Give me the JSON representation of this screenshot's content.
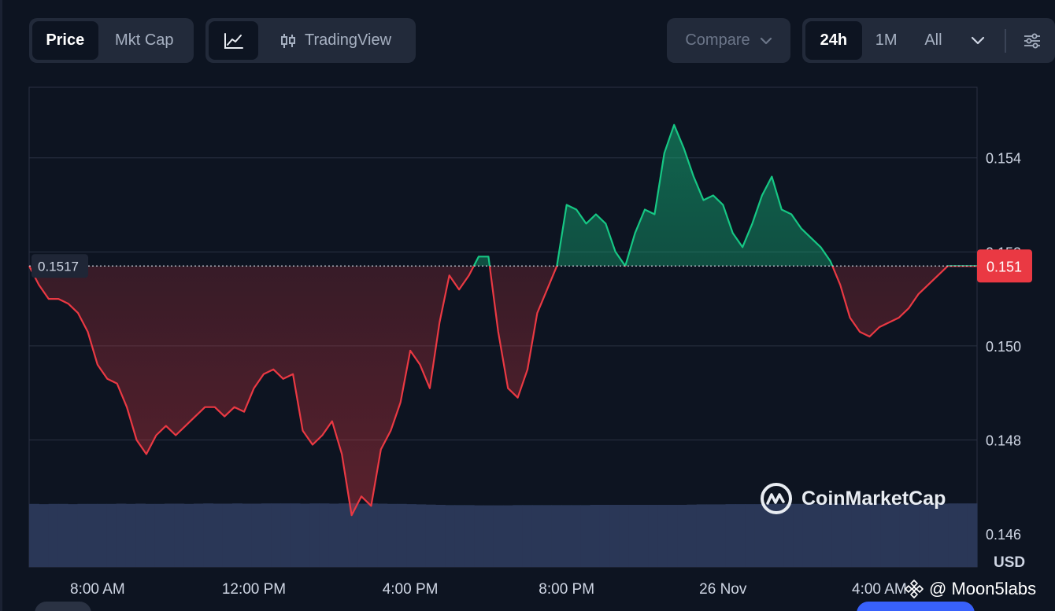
{
  "toolbar": {
    "type_tabs": [
      {
        "label": "Price",
        "active": true
      },
      {
        "label": "Mkt Cap",
        "active": false
      }
    ],
    "view_tabs": [
      {
        "icon": "line-chart-icon",
        "active": true
      },
      {
        "label": "TradingView",
        "icon": "candlestick-icon",
        "active": false
      }
    ],
    "compare_label": "Compare",
    "range_tabs": [
      {
        "label": "24h",
        "active": true
      },
      {
        "label": "1M",
        "active": false
      },
      {
        "label": "All",
        "active": false
      }
    ]
  },
  "watermark": "CoinMarketCap",
  "credit": "@ Moon5labs",
  "colors": {
    "up": "#16c784",
    "down": "#ea3943",
    "volume": "#2a3757",
    "background": "#0d1421",
    "badge": "#ea3943"
  },
  "chart_data": {
    "type": "area",
    "reference_label": "0.1517",
    "reference_value": 0.1517,
    "current_price_label": "0.151",
    "y_tick_labels": [
      "0.154",
      "0.152",
      "0.150",
      "0.148",
      "0.146"
    ],
    "y_ticks": [
      0.154,
      0.152,
      0.15,
      0.148,
      0.146
    ],
    "ylim": [
      0.1453,
      0.1555
    ],
    "y_unit_label": "USD",
    "x_tick_labels": [
      "8:00 AM",
      "12:00 PM",
      "4:00 PM",
      "8:00 PM",
      "26 Nov",
      "4:00 AM"
    ],
    "x_ticks": [
      8,
      12,
      16,
      20,
      24,
      28
    ],
    "xlim": [
      6.25,
      30.5
    ],
    "series": [
      {
        "x": [
          6.25,
          6.5,
          6.75,
          7.0,
          7.25,
          7.5,
          7.75,
          8.0,
          8.25,
          8.5,
          8.75,
          9.0,
          9.25,
          9.5,
          9.75,
          10.0,
          10.25,
          10.5,
          10.75,
          11.0,
          11.25,
          11.5,
          11.75,
          12.0,
          12.25,
          12.5,
          12.75,
          13.0,
          13.25,
          13.5,
          13.75,
          14.0,
          14.25,
          14.5,
          14.75,
          15.0,
          15.25,
          15.5,
          15.75,
          16.0,
          16.25,
          16.5,
          16.75,
          17.0,
          17.25,
          17.5,
          17.75,
          18.0,
          18.25,
          18.5,
          18.75,
          19.0,
          19.25,
          19.5,
          19.75,
          20.0,
          20.25,
          20.5,
          20.75,
          21.0,
          21.25,
          21.5,
          21.75,
          22.0,
          22.25,
          22.5,
          22.75,
          23.0,
          23.25,
          23.5,
          23.75,
          24.0,
          24.25,
          24.5,
          24.75,
          25.0,
          25.25,
          25.5,
          25.75,
          26.0,
          26.25,
          26.5,
          26.75,
          27.0,
          27.25,
          27.5,
          27.75,
          28.0,
          28.25,
          28.5,
          28.75,
          29.0,
          29.25,
          29.5,
          29.75,
          30.0,
          30.25,
          30.5
        ],
        "y": [
          0.1517,
          0.1513,
          0.151,
          0.151,
          0.1509,
          0.1507,
          0.1503,
          0.1496,
          0.1493,
          0.1492,
          0.1487,
          0.148,
          0.1477,
          0.1481,
          0.1483,
          0.1481,
          0.1483,
          0.1485,
          0.1487,
          0.1487,
          0.1485,
          0.1487,
          0.1486,
          0.1491,
          0.1494,
          0.1495,
          0.1493,
          0.1494,
          0.1482,
          0.1479,
          0.1481,
          0.1484,
          0.1477,
          0.1464,
          0.1468,
          0.1466,
          0.1478,
          0.1482,
          0.1488,
          0.1499,
          0.1496,
          0.1491,
          0.1505,
          0.1515,
          0.1512,
          0.1515,
          0.1519,
          0.1519,
          0.1503,
          0.1491,
          0.1489,
          0.1495,
          0.1507,
          0.1512,
          0.1517,
          0.153,
          0.1529,
          0.1526,
          0.1528,
          0.1526,
          0.152,
          0.1517,
          0.1524,
          0.1529,
          0.1528,
          0.1541,
          0.1547,
          0.1542,
          0.1536,
          0.1531,
          0.1532,
          0.153,
          0.1524,
          0.1521,
          0.1526,
          0.1532,
          0.1536,
          0.1529,
          0.1528,
          0.1525,
          0.1523,
          0.1521,
          0.1518,
          0.1513,
          0.1506,
          0.1503,
          0.1502,
          0.1504,
          0.1505,
          0.1506,
          0.1508,
          0.1511,
          0.1513,
          0.1515,
          0.1517,
          0.1517,
          0.1517,
          0.1517
        ]
      }
    ],
    "volume": [
      0.84,
      0.83,
      0.84,
      0.84,
      0.83,
      0.84,
      0.84,
      0.84,
      0.84,
      0.85,
      0.84,
      0.85,
      0.84,
      0.84,
      0.85,
      0.85,
      0.84,
      0.85,
      0.86,
      0.85,
      0.85,
      0.86,
      0.85,
      0.85,
      0.86,
      0.86,
      0.86,
      0.86,
      0.85,
      0.86,
      0.86,
      0.85,
      0.86,
      0.86,
      0.85,
      0.86,
      0.85,
      0.84,
      0.84,
      0.83,
      0.82,
      0.81,
      0.8,
      0.79,
      0.79,
      0.79,
      0.78,
      0.78,
      0.78,
      0.78,
      0.79,
      0.79,
      0.79,
      0.79,
      0.79,
      0.79,
      0.79,
      0.79,
      0.8,
      0.8,
      0.8,
      0.8,
      0.8,
      0.8,
      0.8,
      0.8,
      0.8,
      0.8,
      0.81,
      0.82,
      0.82,
      0.82,
      0.83,
      0.83,
      0.83,
      0.83,
      0.84,
      0.84,
      0.84,
      0.84,
      0.84,
      0.84,
      0.85,
      0.85,
      0.85,
      0.85,
      0.85,
      0.85,
      0.85,
      0.85,
      0.85,
      0.85,
      0.85,
      0.85,
      0.85,
      0.86,
      0.86,
      0.86
    ]
  }
}
